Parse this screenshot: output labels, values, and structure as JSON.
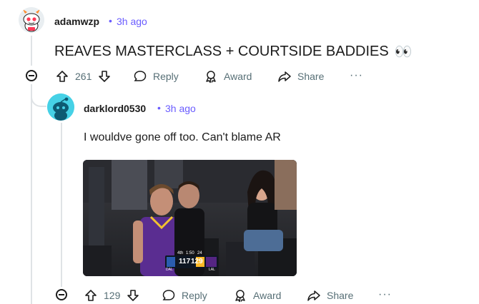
{
  "comment1": {
    "username": "adamwzp",
    "time": "3h ago",
    "text": "REAVES MASTERCLASS + COURTSIDE BADDIES",
    "emoji": "👀",
    "votes": "261",
    "reply_label": "Reply",
    "award_label": "Award",
    "share_label": "Share"
  },
  "comment2": {
    "username": "darklord0530",
    "time": "3h ago",
    "text": "I wouldve gone off too. Can't blame AR",
    "votes": "129",
    "reply_label": "Reply",
    "award_label": "Award",
    "share_label": "Share",
    "scoreboard": {
      "away_score": "117",
      "home_score": "129",
      "away_abbr": "DAL",
      "home_abbr": "LAL",
      "quarter": "4th",
      "clock": "1:50",
      "shot_clock": "24"
    }
  },
  "colors": {
    "meta": "#6a5cff",
    "action_text": "#576f76",
    "thread_line": "#dfe3e6",
    "avatar2_bg": "#46d1e6"
  }
}
